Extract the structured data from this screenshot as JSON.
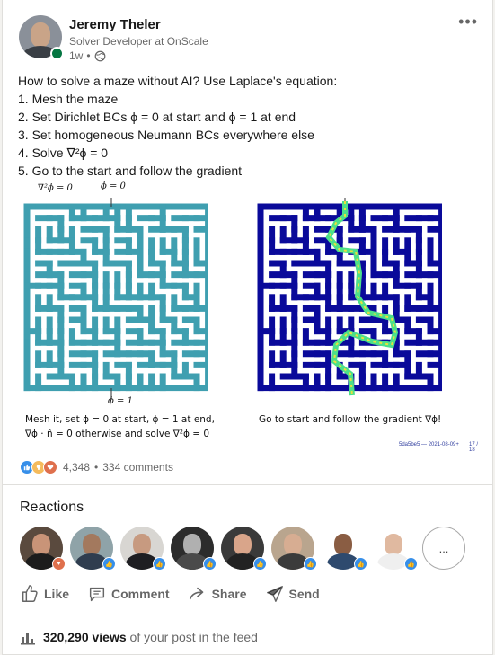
{
  "author": {
    "name": "Jeremy Theler",
    "headline": "Solver Developer at OnScale",
    "time": "1w",
    "time_sep": "•"
  },
  "post_lines": [
    "How to solve a maze without AI? Use Laplace's equation:",
    "1. Mesh the maze",
    "2. Set Dirichlet BCs ϕ = 0 at start and ϕ = 1 at end",
    "3. Set homogeneous Neumann BCs everywhere else",
    "4. Solve ∇²ϕ = 0",
    "5. Go to the start and follow the gradient"
  ],
  "figure": {
    "left_label_laplace": "∇²ϕ = 0",
    "left_label_phi0": "ϕ = 0",
    "left_label_phi1": "ϕ = 1",
    "left_caption_line1": "Mesh it, set ϕ = 0 at start, ϕ = 1 at end,",
    "left_caption_line2": "∇ϕ · n̂ = 0 otherwise and solve ∇²ϕ = 0",
    "right_caption": "Go to start and follow the gradient ∇ϕ!",
    "footer_id": "5da5be5 — 2021-08-09+",
    "footer_page": "17 / 18"
  },
  "social": {
    "reactions_count": "4,348",
    "separator": "•",
    "comments": "334 comments"
  },
  "reactions_section": {
    "title": "Reactions",
    "more_label": "..."
  },
  "actions": {
    "like": "Like",
    "comment": "Comment",
    "share": "Share",
    "send": "Send"
  },
  "views": {
    "count": "320,290 views",
    "suffix": "of your post in the feed"
  },
  "colors": {
    "like_blue": "#378fe9",
    "love_red": "#df704d",
    "insight_yellow": "#f5bb5c",
    "maze_teal": "#3f9fb0",
    "maze_navy": "#0a0a9a",
    "online_green": "#057642"
  }
}
